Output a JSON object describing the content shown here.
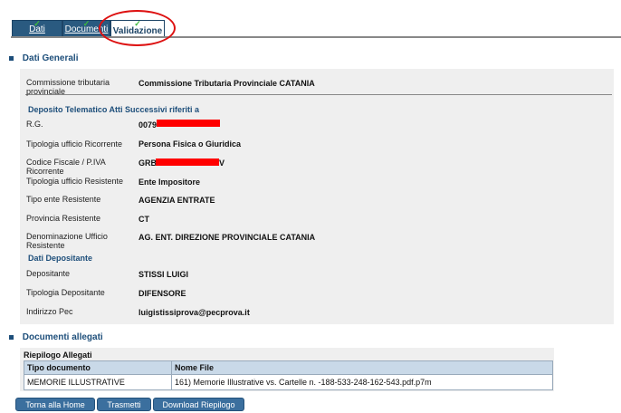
{
  "tabs": [
    {
      "label": "Dati"
    },
    {
      "label": "Documenti"
    },
    {
      "label": "Validazione"
    }
  ],
  "sections": {
    "dati_generali": "Dati Generali",
    "documenti_allegati": "Documenti allegati"
  },
  "dati_generali": {
    "commissione_label": "Commissione tributaria provinciale",
    "commissione_value": "Commissione Tributaria Provinciale CATANIA",
    "deposito_title": "Deposito Telematico Atti Successivi riferiti a",
    "rg_label": "R.G.",
    "rg_value": "0079",
    "tipologia_ricorrente_label": "Tipologia ufficio Ricorrente",
    "tipologia_ricorrente_value": "Persona Fisica o Giuridica",
    "cf_label": "Codice Fiscale / P.IVA Ricorrente",
    "cf_value_prefix": "GRB",
    "cf_value_suffix": "V",
    "tipologia_resistente_label": "Tipologia ufficio Resistente",
    "tipologia_resistente_value": "Ente Impositore",
    "tipo_ente_label": "Tipo ente Resistente",
    "tipo_ente_value": "AGENZIA ENTRATE",
    "provincia_label": "Provincia Resistente",
    "provincia_value": "CT",
    "denominazione_label": "Denominazione Ufficio Resistente",
    "denominazione_value": "AG. ENT. DIREZIONE PROVINCIALE CATANIA",
    "dati_depositante_title": "Dati Depositante",
    "depositante_label": "Depositante",
    "depositante_value": "STISSI LUIGI",
    "tipologia_depositante_label": "Tipologia Depositante",
    "tipologia_depositante_value": "DIFENSORE",
    "pec_label": "Indirizzo Pec",
    "pec_value": "luigistissiprova@pecprova.it"
  },
  "allegati": {
    "riepilogo_title": "Riepilogo Allegati",
    "headers": [
      "Tipo documento",
      "Nome File"
    ],
    "rows": [
      [
        "MEMORIE ILLUSTRATIVE",
        "161) Memorie Illustrative vs. Cartelle n. -188-533-248-162-543.pdf.p7m"
      ]
    ]
  },
  "buttons": {
    "home": "Torna alla Home",
    "trasmetti": "Trasmetti",
    "download": "Download Riepilogo"
  },
  "colors": {
    "tab_bg": "#2a5a80",
    "accent": "#1d4e7a",
    "panel_bg": "#efefef",
    "redaction": "#ff0000",
    "annotation_ring": "#dd1111"
  }
}
